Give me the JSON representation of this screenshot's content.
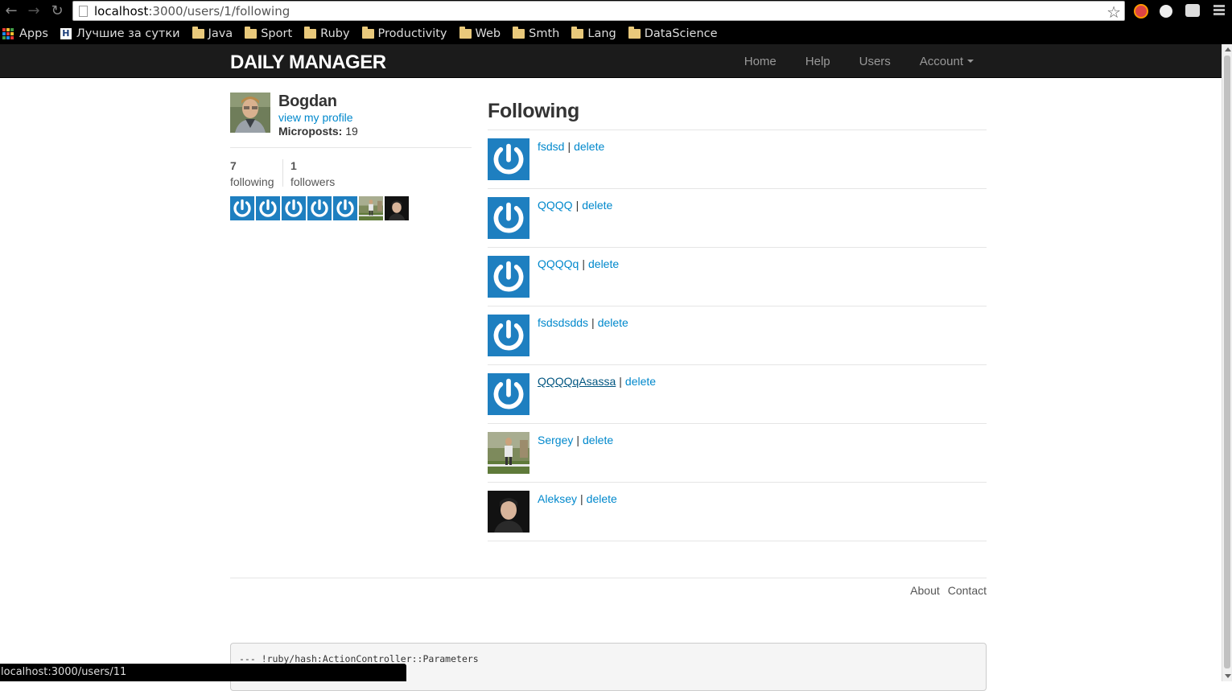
{
  "browser": {
    "url_host": "localhost",
    "url_rest": ":3000/users/1/following",
    "status_url": "localhost:3000/users/11",
    "bookmarks": [
      {
        "label": "Apps",
        "icon": "apps-grid-icon"
      },
      {
        "label": "Лучшие за сутки",
        "icon": "habr-icon"
      },
      {
        "label": "Java",
        "icon": "folder-icon"
      },
      {
        "label": "Sport",
        "icon": "folder-icon"
      },
      {
        "label": "Ruby",
        "icon": "folder-icon"
      },
      {
        "label": "Productivity",
        "icon": "folder-icon"
      },
      {
        "label": "Web",
        "icon": "folder-icon"
      },
      {
        "label": "Smth",
        "icon": "folder-icon"
      },
      {
        "label": "Lang",
        "icon": "folder-icon"
      },
      {
        "label": "DataScience",
        "icon": "folder-icon"
      }
    ]
  },
  "navbar": {
    "brand": "DAILY MANAGER",
    "links": [
      "Home",
      "Help",
      "Users",
      "Account"
    ]
  },
  "user": {
    "name": "Bogdan",
    "profile_link": "view my profile",
    "microposts_label": "Microposts:",
    "microposts_count": "19",
    "following_count": "7",
    "following_label": "following",
    "followers_count": "1",
    "followers_label": "followers"
  },
  "page": {
    "title": "Following",
    "delete_label": "delete",
    "following": [
      {
        "name": "fsdsd",
        "avatar": "gravatar-default"
      },
      {
        "name": "QQQQ",
        "avatar": "gravatar-default"
      },
      {
        "name": "QQQQq",
        "avatar": "gravatar-default"
      },
      {
        "name": "fsdsdsdds",
        "avatar": "gravatar-default"
      },
      {
        "name": "QQQQqAsassa",
        "avatar": "gravatar-default"
      },
      {
        "name": "Sergey",
        "avatar": "photo-outdoor"
      },
      {
        "name": "Aleksey",
        "avatar": "photo-portrait"
      }
    ]
  },
  "footer": {
    "links": [
      "About",
      "Contact"
    ]
  },
  "debug": {
    "text": "--- !ruby/hash:ActionController::Parameters"
  },
  "colors": {
    "link": "#0088cc",
    "navbar_bg": "#1b1b1b",
    "gravatar_blue": "#1e7fc0"
  }
}
